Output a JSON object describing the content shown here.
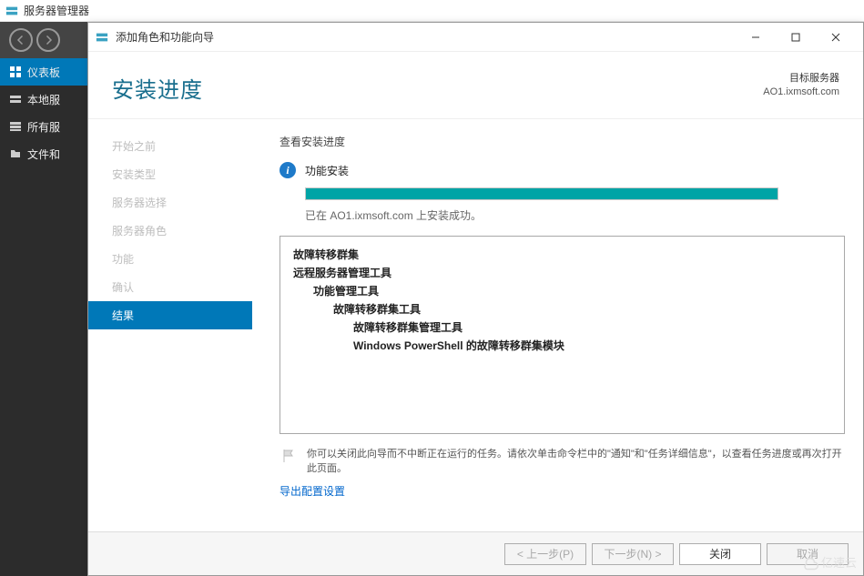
{
  "parent": {
    "title": "服务器管理器",
    "sidebar": [
      {
        "label": "仪表板",
        "icon": "dashboard",
        "active": true
      },
      {
        "label": "本地服",
        "icon": "server",
        "active": false
      },
      {
        "label": "所有服",
        "icon": "server",
        "active": false
      },
      {
        "label": "文件和",
        "icon": "files",
        "active": false
      }
    ]
  },
  "modal": {
    "windowTitle": "添加角色和功能向导",
    "heading": "安装进度",
    "destination": {
      "label": "目标服务器",
      "server": "AO1.ixmsoft.com"
    },
    "steps": [
      "开始之前",
      "安装类型",
      "服务器选择",
      "服务器角色",
      "功能",
      "确认",
      "结果"
    ],
    "activeStep": 6,
    "progress": {
      "viewLabel": "查看安装进度",
      "statusTitle": "功能安装",
      "percent": 100,
      "doneMessage": "已在 AO1.ixmsoft.com 上安装成功。"
    },
    "features": {
      "l0a": "故障转移群集",
      "l0b": "远程服务器管理工具",
      "l1": "功能管理工具",
      "l2": "故障转移群集工具",
      "l3a": "故障转移群集管理工具",
      "l3b": "Windows PowerShell 的故障转移群集模块"
    },
    "note": "你可以关闭此向导而不中断正在运行的任务。请依次单击命令栏中的\"通知\"和\"任务详细信息\"，以查看任务进度或再次打开此页面。",
    "exportLink": "导出配置设置",
    "buttons": {
      "prev": "< 上一步(P)",
      "next": "下一步(N) >",
      "close": "关闭",
      "cancel": "取消"
    }
  },
  "watermark": "亿速云"
}
